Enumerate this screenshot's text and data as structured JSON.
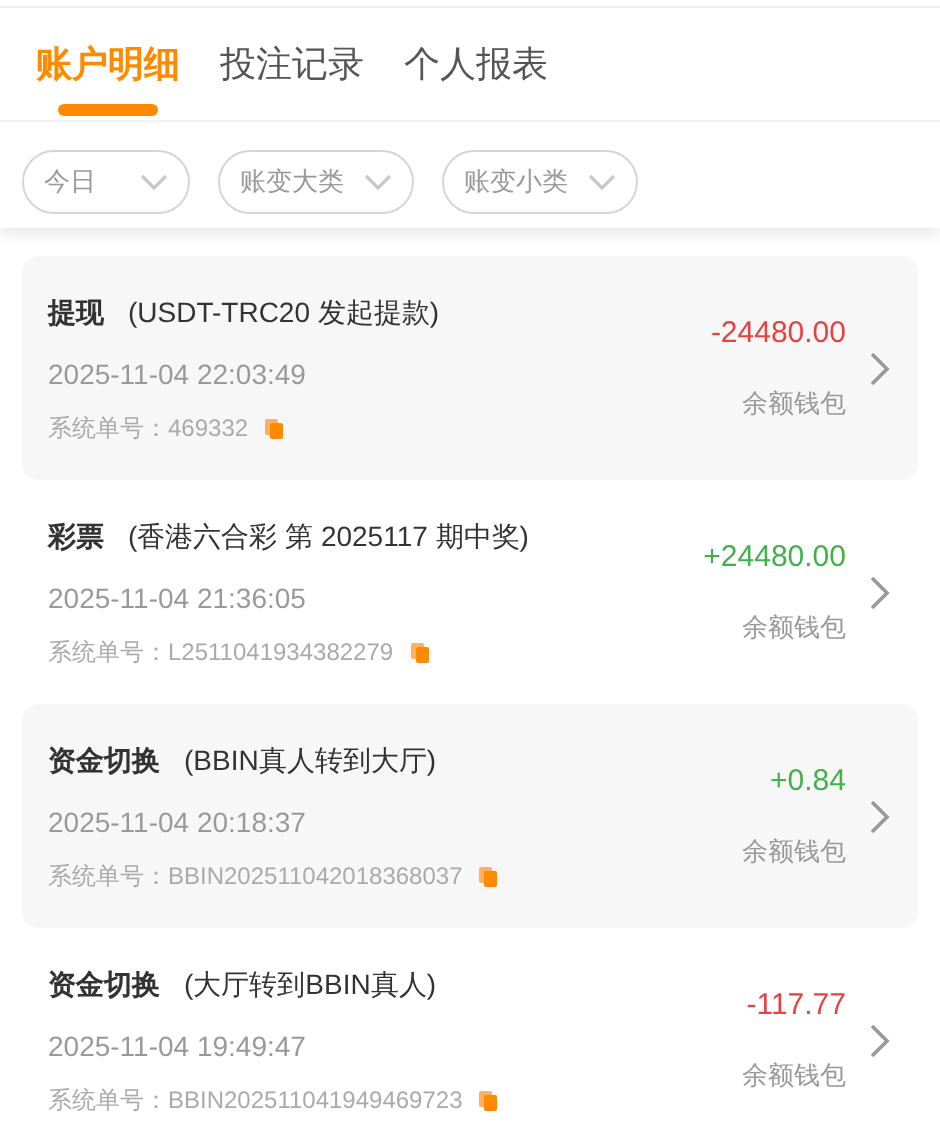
{
  "tabs": [
    {
      "label": "账户明细",
      "selected": true
    },
    {
      "label": "投注记录",
      "selected": false
    },
    {
      "label": "个人报表",
      "selected": false
    }
  ],
  "filters": [
    {
      "label": "今日"
    },
    {
      "label": "账变大类"
    },
    {
      "label": "账变小类"
    }
  ],
  "records": [
    {
      "type": "提现",
      "detail": "(USDT-TRC20 发起提款)",
      "time": "2025-11-04 22:03:49",
      "order": "系统单号：469332",
      "amount": "-24480.00",
      "kind": "debit",
      "wallet": "余额钱包"
    },
    {
      "type": "彩票",
      "detail": "(香港六合彩 第 2025117 期中奖)",
      "time": "2025-11-04 21:36:05",
      "order": "系统单号：L2511041934382279",
      "amount": "+24480.00",
      "kind": "credit",
      "wallet": "余额钱包"
    },
    {
      "type": "资金切换",
      "detail": "(BBIN真人转到大厅)",
      "time": "2025-11-04 20:18:37",
      "order": "系统单号：BBIN202511042018368037",
      "amount": "+0.84",
      "kind": "credit",
      "wallet": "余额钱包"
    },
    {
      "type": "资金切换",
      "detail": "(大厅转到BBIN真人)",
      "time": "2025-11-04 19:49:47",
      "order": "系统单号：BBIN202511041949469723",
      "amount": "-117.77",
      "kind": "debit",
      "wallet": "余额钱包"
    }
  ]
}
